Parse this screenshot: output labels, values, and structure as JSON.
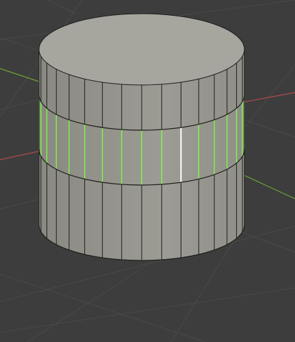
{
  "viewport": {
    "background_color": "#3d3d3d",
    "grid_color": "#4a4a4a",
    "x_axis_color": "#b34a4a",
    "y_axis_color": "#6fa33a",
    "mesh_face_color": "#9c9c94",
    "mesh_top_color": "#a6a69e",
    "mesh_edge_color": "#1c1c1c",
    "selection_color": "#7dff3a",
    "active_edge_color": "#ffffff"
  },
  "object": {
    "shape": "cylinder",
    "mode": "edit-mode",
    "selection": "edge-loop"
  }
}
